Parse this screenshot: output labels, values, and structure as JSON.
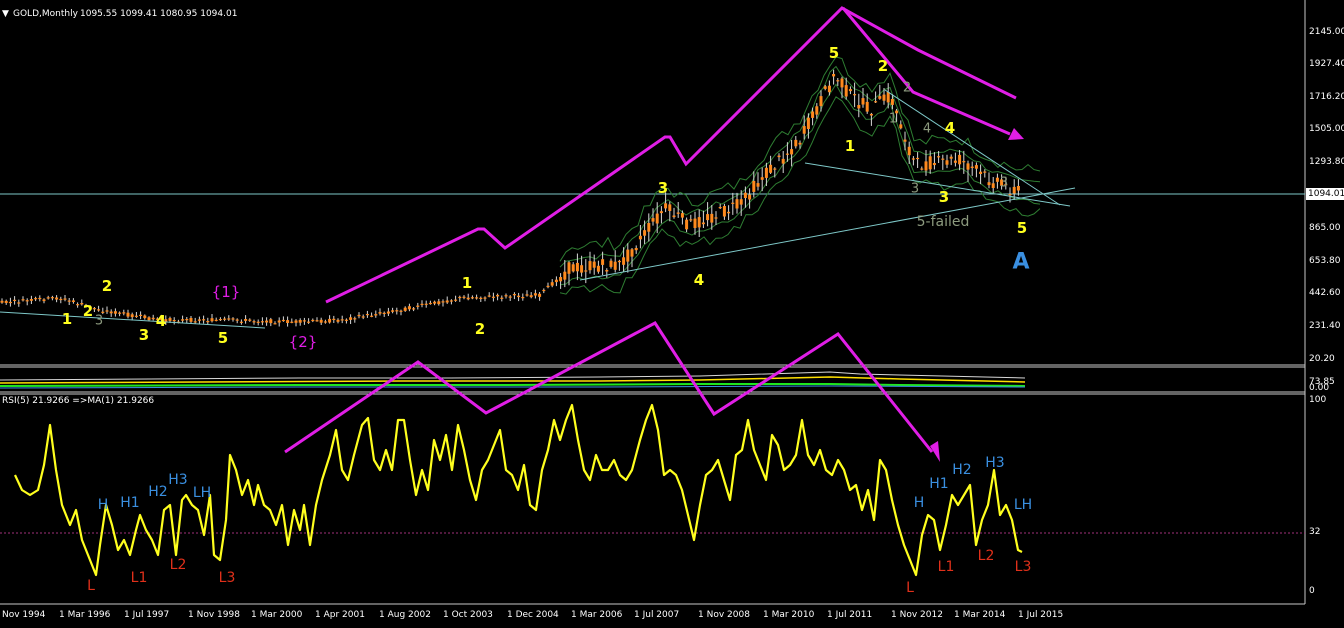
{
  "window": {
    "dropdown_glyph": "▼",
    "symbol": "GOLD,Monthly",
    "ohlc": "1095.55 1099.41 1080.95 1094.01"
  },
  "price_axis": {
    "ticks": [
      "2145.00",
      "1927.40",
      "1716.20",
      "1505.00",
      "1293.80",
      "865.00",
      "653.80",
      "442.60",
      "231.40",
      "20.20"
    ],
    "current_price": "1094.01"
  },
  "mid_panel": {
    "ticks": [
      "73.85",
      "0.00"
    ]
  },
  "rsi_panel": {
    "label": "RSI(5) 21.9266 =>MA(1) 21.9266",
    "ticks": [
      "100",
      "32",
      "0"
    ],
    "level": 32
  },
  "time_axis": {
    "labels": [
      "Nov 1994",
      "1 Mar 1996",
      "1 Jul 1997",
      "1 Nov 1998",
      "1 Mar 2000",
      "1 Apr 2001",
      "1 Aug 2002",
      "1 Oct 2003",
      "1 Dec 2004",
      "1 Mar 2006",
      "1 Jul 2007",
      "1 Nov 2008",
      "1 Mar 2010",
      "1 Jul 2011",
      "1 Nov 2012",
      "1 Mar 2014",
      "1 Jul 2015"
    ]
  },
  "wave_labels": {
    "primary": [
      "1",
      "2",
      "3",
      "4",
      "5",
      "1",
      "2",
      "3",
      "4",
      "5",
      "1",
      "2",
      "3",
      "4",
      "5"
    ],
    "degree": [
      "{1}",
      "{2}"
    ],
    "minor": [
      "2",
      "3",
      "1",
      "2",
      "3",
      "4",
      "3"
    ],
    "failed": "5-failed",
    "corrective": "A"
  },
  "rsi_labels": {
    "highs": [
      "H",
      "H1",
      "H2",
      "H3",
      "LH",
      "H",
      "H1",
      "H2",
      "H3",
      "LH"
    ],
    "lows": [
      "L",
      "L1",
      "L2",
      "L3",
      "L",
      "L1",
      "L2",
      "L3"
    ]
  },
  "colors": {
    "background": "#000000",
    "candle_body": "#ff8a1e",
    "candle_wick": "#d8d8d8",
    "envelope": "#2e7d32",
    "trendline": "#7ec8c8",
    "arrow": "#e01ee6",
    "rsi_line": "#ffff1e",
    "level_line": "#a0307a",
    "wave_label": "#ffff1e",
    "high_label": "#3a8fe0",
    "low_label": "#e0301a"
  }
}
